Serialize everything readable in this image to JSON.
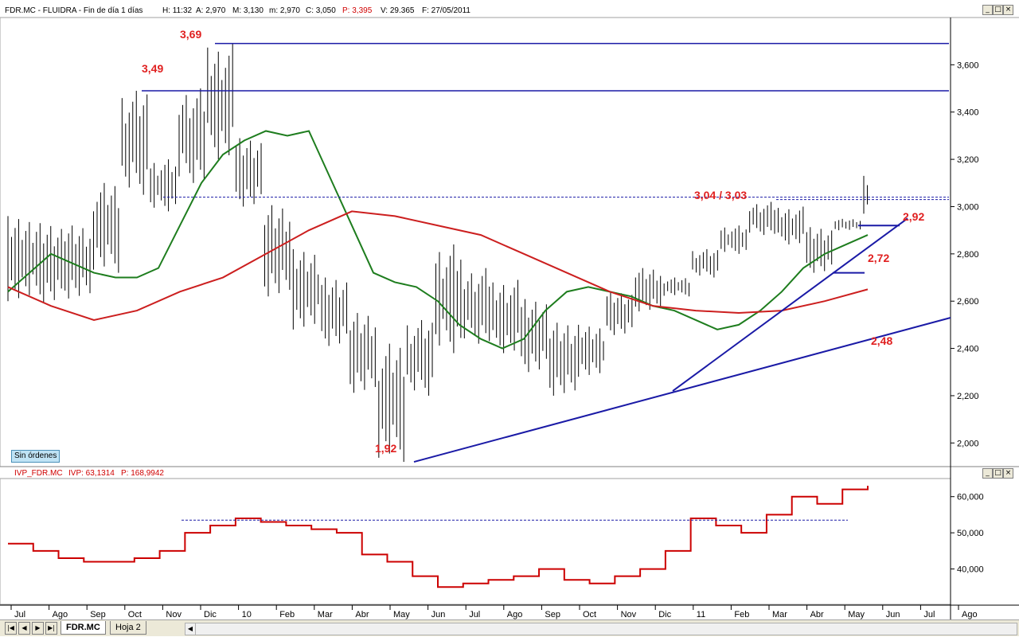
{
  "window": {
    "main_header": {
      "symbol": "FDR.MC - FLUIDRA - Fin de día 1 días",
      "h": "H: 11:32",
      "a": "A: 2,970",
      "m": "M: 3,130",
      "min": "m: 2,970",
      "c": "C: 3,050",
      "p": "P: 3,395",
      "v": "V: 29.365",
      "f": "F: 27/05/2011"
    },
    "sub_header": {
      "name": "IVP_FDR.MC",
      "ivp": "IVP: 63,1314",
      "p": "P: 168,9942"
    },
    "buttons": {
      "minimize": "_",
      "restore": "□",
      "close": "×"
    },
    "orders_label": "Sin órdenes",
    "tabs": [
      {
        "label": "FDR.MC",
        "active": true
      },
      {
        "label": "Hoja 2",
        "active": false
      }
    ],
    "nav_buttons": [
      "|◀",
      "◀",
      "▶",
      "▶|"
    ],
    "colors": {
      "candle": "#000000",
      "ma_short": "#1e7d1e",
      "ma_long": "#cc1f1f",
      "trend": "#1a1aa6",
      "annotation": "#e02020",
      "ivp": "#cc0000"
    }
  },
  "chart_data": [
    {
      "type": "line",
      "ylim": [
        1.9,
        3.8
      ],
      "yticks": [
        "2,000",
        "2,200",
        "2,400",
        "2,600",
        "2,800",
        "3,000",
        "3,200",
        "3,400",
        "3,600"
      ],
      "xtick_labels": [
        "Jul",
        "Ago",
        "Sep",
        "Oct",
        "Nov",
        "Dic",
        "10",
        "Feb",
        "Mar",
        "Abr",
        "May",
        "Jun",
        "Jul",
        "Ago",
        "Sep",
        "Oct",
        "Nov",
        "Dic",
        "11",
        "Feb",
        "Mar",
        "Abr",
        "May",
        "Jun",
        "Jul",
        "Ago"
      ],
      "ma_short": [
        [
          0,
          2.64
        ],
        [
          1,
          2.72
        ],
        [
          2,
          2.8
        ],
        [
          3,
          2.76
        ],
        [
          4,
          2.72
        ],
        [
          5,
          2.7
        ],
        [
          6,
          2.7
        ],
        [
          7,
          2.74
        ],
        [
          8,
          2.92
        ],
        [
          9,
          3.1
        ],
        [
          10,
          3.22
        ],
        [
          11,
          3.28
        ],
        [
          12,
          3.32
        ],
        [
          13,
          3.3
        ],
        [
          14,
          3.32
        ],
        [
          15,
          3.12
        ],
        [
          16,
          2.92
        ],
        [
          17,
          2.72
        ],
        [
          18,
          2.68
        ],
        [
          19,
          2.66
        ],
        [
          20,
          2.6
        ],
        [
          21,
          2.5
        ],
        [
          22,
          2.44
        ],
        [
          23,
          2.4
        ],
        [
          24,
          2.44
        ],
        [
          25,
          2.56
        ],
        [
          26,
          2.64
        ],
        [
          27,
          2.66
        ],
        [
          28,
          2.64
        ],
        [
          29,
          2.62
        ],
        [
          30,
          2.58
        ],
        [
          31,
          2.56
        ],
        [
          32,
          2.52
        ],
        [
          33,
          2.48
        ],
        [
          34,
          2.5
        ],
        [
          35,
          2.56
        ],
        [
          36,
          2.64
        ],
        [
          37,
          2.74
        ],
        [
          38,
          2.8
        ],
        [
          39,
          2.84
        ],
        [
          40,
          2.88
        ]
      ],
      "ma_long": [
        [
          0,
          2.66
        ],
        [
          1,
          2.58
        ],
        [
          2,
          2.52
        ],
        [
          3,
          2.56
        ],
        [
          4,
          2.64
        ],
        [
          5,
          2.7
        ],
        [
          6,
          2.8
        ],
        [
          7,
          2.9
        ],
        [
          8,
          2.98
        ],
        [
          9,
          2.96
        ],
        [
          10,
          2.92
        ],
        [
          11,
          2.88
        ],
        [
          12,
          2.8
        ],
        [
          13,
          2.72
        ],
        [
          14,
          2.64
        ],
        [
          15,
          2.58
        ],
        [
          16,
          2.56
        ],
        [
          17,
          2.55
        ],
        [
          18,
          2.56
        ],
        [
          19,
          2.6
        ],
        [
          20,
          2.65
        ]
      ],
      "price_high": [
        2.96,
        2.93,
        2.92,
        3.1,
        3.49,
        3.2,
        3.5,
        3.69,
        3.3,
        3.02,
        2.82,
        2.7,
        2.55,
        2.42,
        2.52,
        2.84,
        2.74,
        2.69,
        2.62,
        2.52,
        2.5,
        2.64,
        2.74,
        2.7,
        2.82,
        2.92,
        3.02,
        3.0,
        2.92,
        2.95,
        3.13
      ],
      "price_low": [
        2.6,
        2.58,
        2.6,
        2.72,
        3.05,
        2.98,
        3.1,
        3.2,
        3.0,
        2.62,
        2.48,
        2.4,
        2.2,
        1.92,
        2.2,
        2.38,
        2.42,
        2.38,
        2.3,
        2.2,
        2.28,
        2.45,
        2.55,
        2.62,
        2.7,
        2.8,
        2.88,
        2.84,
        2.72,
        2.9,
        2.97
      ],
      "price_x": [
        0,
        1,
        2,
        3,
        4,
        5,
        6,
        7,
        8,
        9,
        10,
        11,
        12,
        13,
        14,
        15,
        16,
        17,
        18,
        19,
        20,
        21,
        22,
        23,
        24,
        25,
        26,
        27,
        28,
        29,
        30
      ],
      "resistance_lines": [
        {
          "y": 3.69
        },
        {
          "y": 3.49
        },
        {
          "y": 3.04
        },
        {
          "y": 3.03
        }
      ],
      "annotations": [
        "3,69",
        "3,49",
        "3,04 / 3,03",
        "2,92",
        "2,72",
        "2,48",
        "1,92"
      ]
    },
    {
      "type": "line",
      "ylim": [
        30,
        65
      ],
      "yticks": [
        "40,000",
        "50,000",
        "60,000"
      ],
      "series_values": [
        47,
        45,
        43,
        42,
        42,
        43,
        45,
        50,
        52,
        54,
        53,
        52,
        51,
        50,
        44,
        42,
        38,
        35,
        36,
        37,
        38,
        40,
        37,
        36,
        38,
        40,
        45,
        54,
        52,
        50,
        55,
        60,
        58,
        62,
        63
      ],
      "dashed_level": 53.5
    }
  ]
}
